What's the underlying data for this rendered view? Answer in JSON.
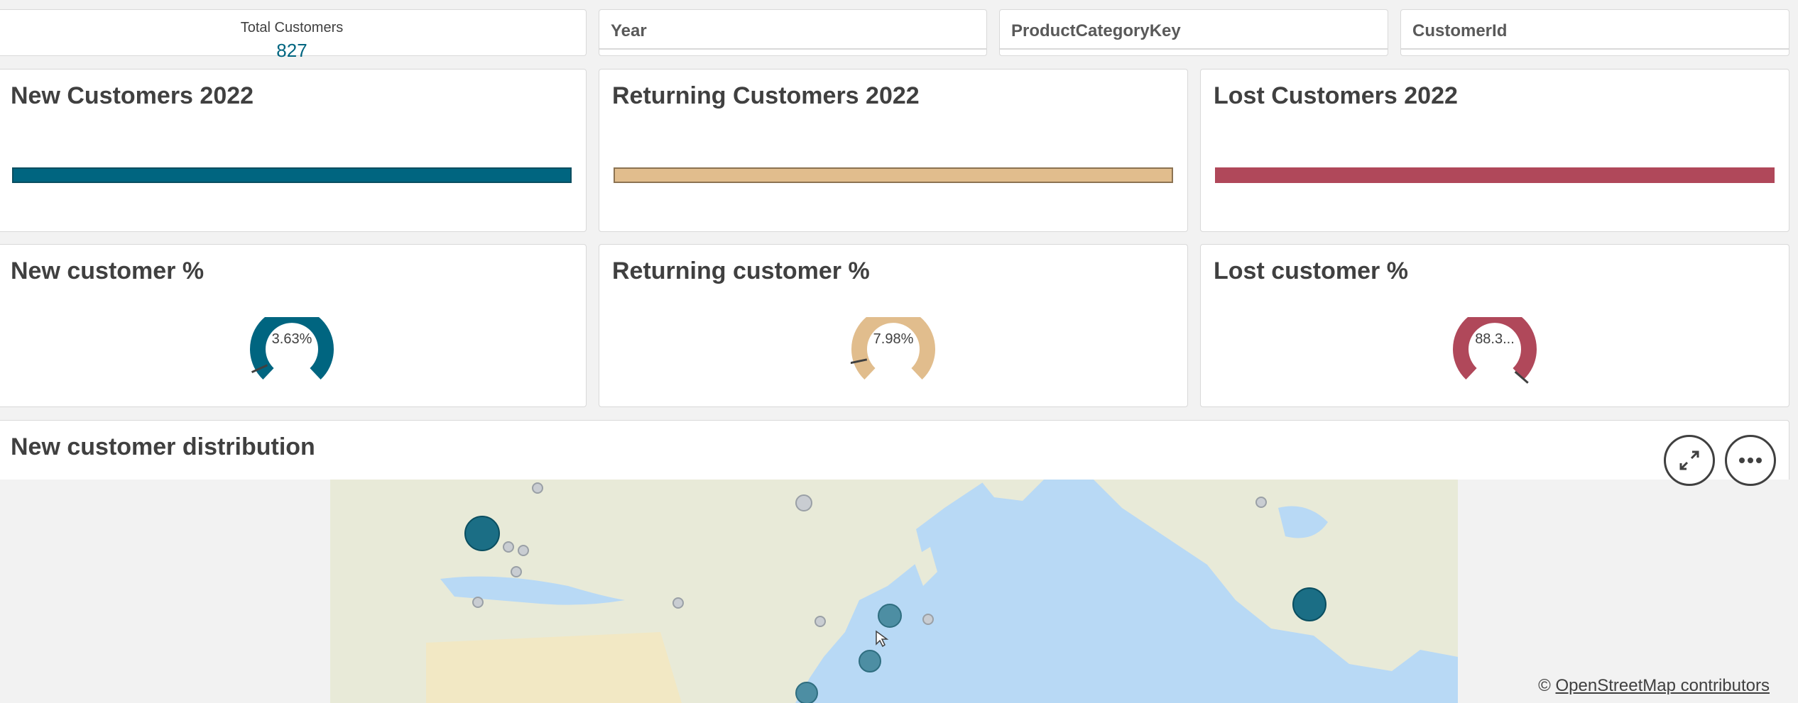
{
  "filters": {
    "kpi_total_customers": {
      "label": "Total Customers",
      "value": "827"
    },
    "year": "Year",
    "product_category": "ProductCategoryKey",
    "customer_id": "CustomerId"
  },
  "summary_cards": [
    {
      "title": "New Customers 2022",
      "color": "#006580"
    },
    {
      "title": "Returning Customers 2022",
      "color": "#e1bd8d"
    },
    {
      "title": "Lost Customers 2022",
      "color": "#b0485a"
    }
  ],
  "gauges": [
    {
      "title": "New customer %",
      "value_text": "3.63%",
      "value": 3.63,
      "color": "#006580"
    },
    {
      "title": "Returning customer %",
      "value_text": "7.98%",
      "value": 7.98,
      "color": "#e1bd8d"
    },
    {
      "title": "Lost customer %",
      "value_text": "88.3...",
      "value": 88.3,
      "color": "#b0485a"
    }
  ],
  "map_panel": {
    "title": "New customer distribution",
    "attribution_prefix": "©",
    "attribution_link": "OpenStreetMap contributors"
  },
  "icons": {
    "expand": "expand-icon",
    "more": "more-options-icon",
    "cursor": "mouse-pointer-icon"
  },
  "colors": {
    "new": "#006580",
    "returning": "#e1bd8d",
    "lost": "#b0485a",
    "ocean": "#b8d9f5",
    "land": "#e8ead8"
  }
}
